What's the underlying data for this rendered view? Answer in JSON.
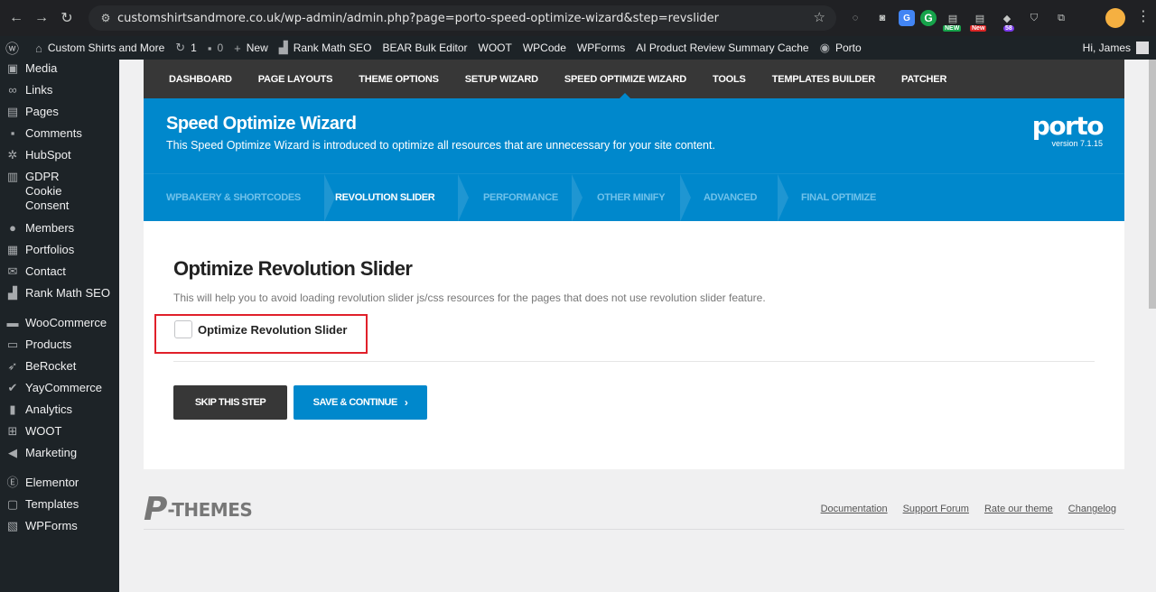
{
  "browser": {
    "url": "customshirtsandmore.co.uk/wp-admin/admin.php?page=porto-speed-optimize-wizard&step=revslider",
    "badges": {
      "new_green": "NEW",
      "new_red": "New",
      "count": "58"
    }
  },
  "adminbar": {
    "site_name": "Custom Shirts and More",
    "updates_count": "1",
    "comments_count": "0",
    "new_label": "New",
    "items": [
      "Rank Math SEO",
      "BEAR Bulk Editor",
      "WOOT",
      "WPCode",
      "WPForms",
      "AI Product Review Summary Cache"
    ],
    "porto_label": "Porto",
    "greeting": "Hi, James"
  },
  "sidebar": {
    "items": [
      {
        "label": "Media",
        "icon": "media-icon"
      },
      {
        "label": "Links",
        "icon": "link-icon"
      },
      {
        "label": "Pages",
        "icon": "pages-icon"
      },
      {
        "label": "Comments",
        "icon": "comments-icon"
      },
      {
        "label": "HubSpot",
        "icon": "hubspot-icon"
      },
      {
        "label": "GDPR Cookie Consent",
        "icon": "lock-icon"
      },
      {
        "label": "Members",
        "icon": "members-icon"
      },
      {
        "label": "Portfolios",
        "icon": "portfolios-icon"
      },
      {
        "label": "Contact",
        "icon": "mail-icon"
      },
      {
        "label": "Rank Math SEO",
        "icon": "rankmath-icon"
      },
      {
        "label": "WooCommerce",
        "icon": "woocommerce-icon"
      },
      {
        "label": "Products",
        "icon": "products-icon"
      },
      {
        "label": "BeRocket",
        "icon": "rocket-icon"
      },
      {
        "label": "YayCommerce",
        "icon": "yay-icon"
      },
      {
        "label": "Analytics",
        "icon": "analytics-icon"
      },
      {
        "label": "WOOT",
        "icon": "grid-icon"
      },
      {
        "label": "Marketing",
        "icon": "megaphone-icon"
      },
      {
        "label": "Elementor",
        "icon": "elementor-icon"
      },
      {
        "label": "Templates",
        "icon": "templates-icon"
      },
      {
        "label": "WPForms",
        "icon": "forms-icon"
      }
    ]
  },
  "topnav": {
    "items": [
      "DASHBOARD",
      "PAGE LAYOUTS",
      "THEME OPTIONS",
      "SETUP WIZARD",
      "SPEED OPTIMIZE WIZARD",
      "TOOLS",
      "TEMPLATES BUILDER",
      "PATCHER"
    ],
    "active": "SPEED OPTIMIZE WIZARD"
  },
  "banner": {
    "title": "Speed Optimize Wizard",
    "subtitle": "This Speed Optimize Wizard is introduced to optimize all resources that are unnecessary for your site content.",
    "logo": "porto",
    "version": "version 7.1.15"
  },
  "steps": {
    "items": [
      "WPBAKERY & SHORTCODES",
      "REVOLUTION SLIDER",
      "PERFORMANCE",
      "OTHER MINIFY",
      "ADVANCED",
      "FINAL OPTIMIZE"
    ],
    "active": "REVOLUTION SLIDER"
  },
  "content": {
    "title": "Optimize Revolution Slider",
    "description": "This will help you to avoid loading revolution slider js/css resources for the pages that does not use revolution slider feature.",
    "checkbox_label": "Optimize Revolution Slider",
    "checkbox_checked": false,
    "skip_label": "SKIP THIS STEP",
    "save_label": "SAVE & CONTINUE"
  },
  "footer": {
    "logo_text": "-THEMES",
    "logo_letter": "P",
    "links": [
      "Documentation",
      "Support Forum",
      "Rate our theme",
      "Changelog"
    ]
  },
  "colors": {
    "accent": "#0088cc",
    "dark": "#373737",
    "highlight": "#e0202a"
  }
}
